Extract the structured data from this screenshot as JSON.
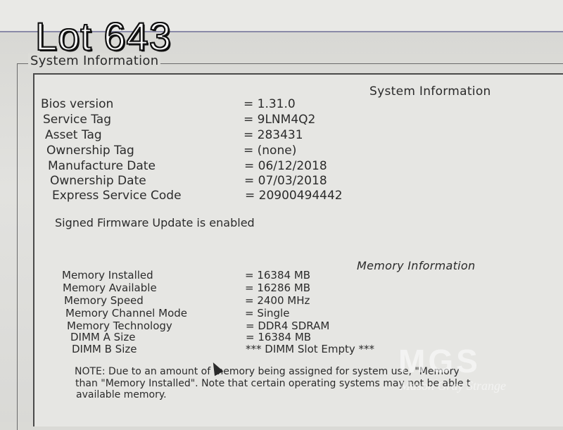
{
  "overlay": {
    "lot": "Lot 643"
  },
  "group_title": "System Information",
  "system": {
    "heading": "System Information",
    "rows": [
      {
        "label": "Bios version",
        "value": "= 1.31.0"
      },
      {
        "label": "Service Tag",
        "value": "= 9LNM4Q2"
      },
      {
        "label": "Asset Tag",
        "value": "= 283431"
      },
      {
        "label": "Ownership Tag",
        "value": "= (none)"
      },
      {
        "label": "Manufacture Date",
        "value": "= 06/12/2018"
      },
      {
        "label": "Ownership Date",
        "value": "= 07/03/2018"
      },
      {
        "label": "Express Service Code",
        "value": "= 20900494442"
      }
    ],
    "firmware": "Signed Firmware Update is enabled"
  },
  "memory": {
    "heading": "Memory Information",
    "rows": [
      {
        "label": "Memory Installed",
        "value": "= 16384 MB"
      },
      {
        "label": "Memory Available",
        "value": "= 16286 MB"
      },
      {
        "label": "Memory Speed",
        "value": "= 2400 MHz"
      },
      {
        "label": "Memory Channel Mode",
        "value": "= Single"
      },
      {
        "label": "Memory Technology",
        "value": "= DDR4 SDRAM"
      },
      {
        "label": "DIMM A Size",
        "value": "= 16384 MB"
      },
      {
        "label": "DIMM B Size",
        "value": "*** DIMM Slot Empty ***"
      }
    ],
    "note_lines": [
      "NOTE: Due to an amount of memory being assigned for system use, \"Memory",
      "than \"Memory Installed\". Note that certain operating systems may not be able t",
      "available memory."
    ]
  },
  "watermark": {
    "letters": "MGS",
    "subtitle": "Mason Gray Strange"
  }
}
